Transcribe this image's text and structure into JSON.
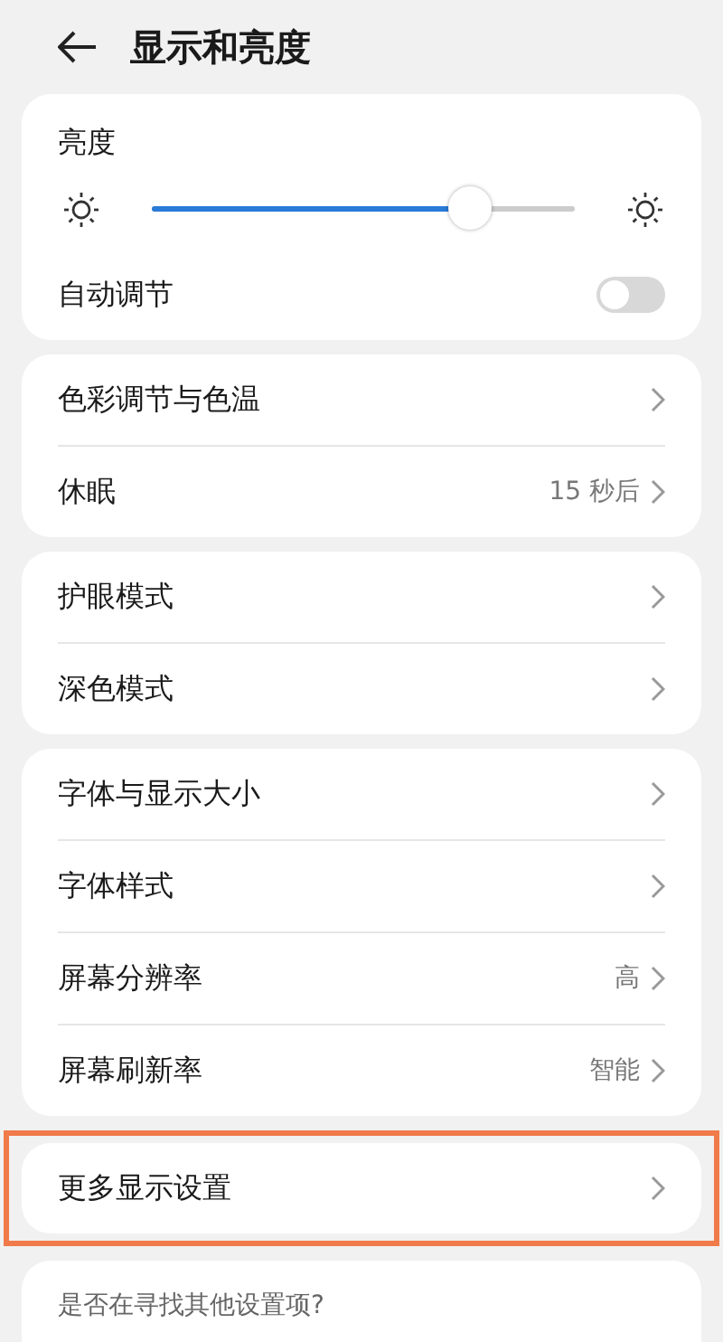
{
  "header": {
    "title": "显示和亮度"
  },
  "brightness": {
    "label": "亮度",
    "level": 0.75,
    "auto": {
      "label": "自动调节",
      "on": false
    }
  },
  "groups": [
    {
      "items": [
        {
          "label": "色彩调节与色温"
        },
        {
          "label": "休眠",
          "value": "15 秒后"
        }
      ]
    },
    {
      "items": [
        {
          "label": "护眼模式"
        },
        {
          "label": "深色模式"
        }
      ]
    },
    {
      "items": [
        {
          "label": "字体与显示大小"
        },
        {
          "label": "字体样式"
        },
        {
          "label": "屏幕分辨率",
          "value": "高"
        },
        {
          "label": "屏幕刷新率",
          "value": "智能"
        }
      ]
    },
    {
      "items": [
        {
          "label": "更多显示设置",
          "highlighted": true
        }
      ]
    }
  ],
  "suggestion": {
    "text": "是否在寻找其他设置项?"
  }
}
